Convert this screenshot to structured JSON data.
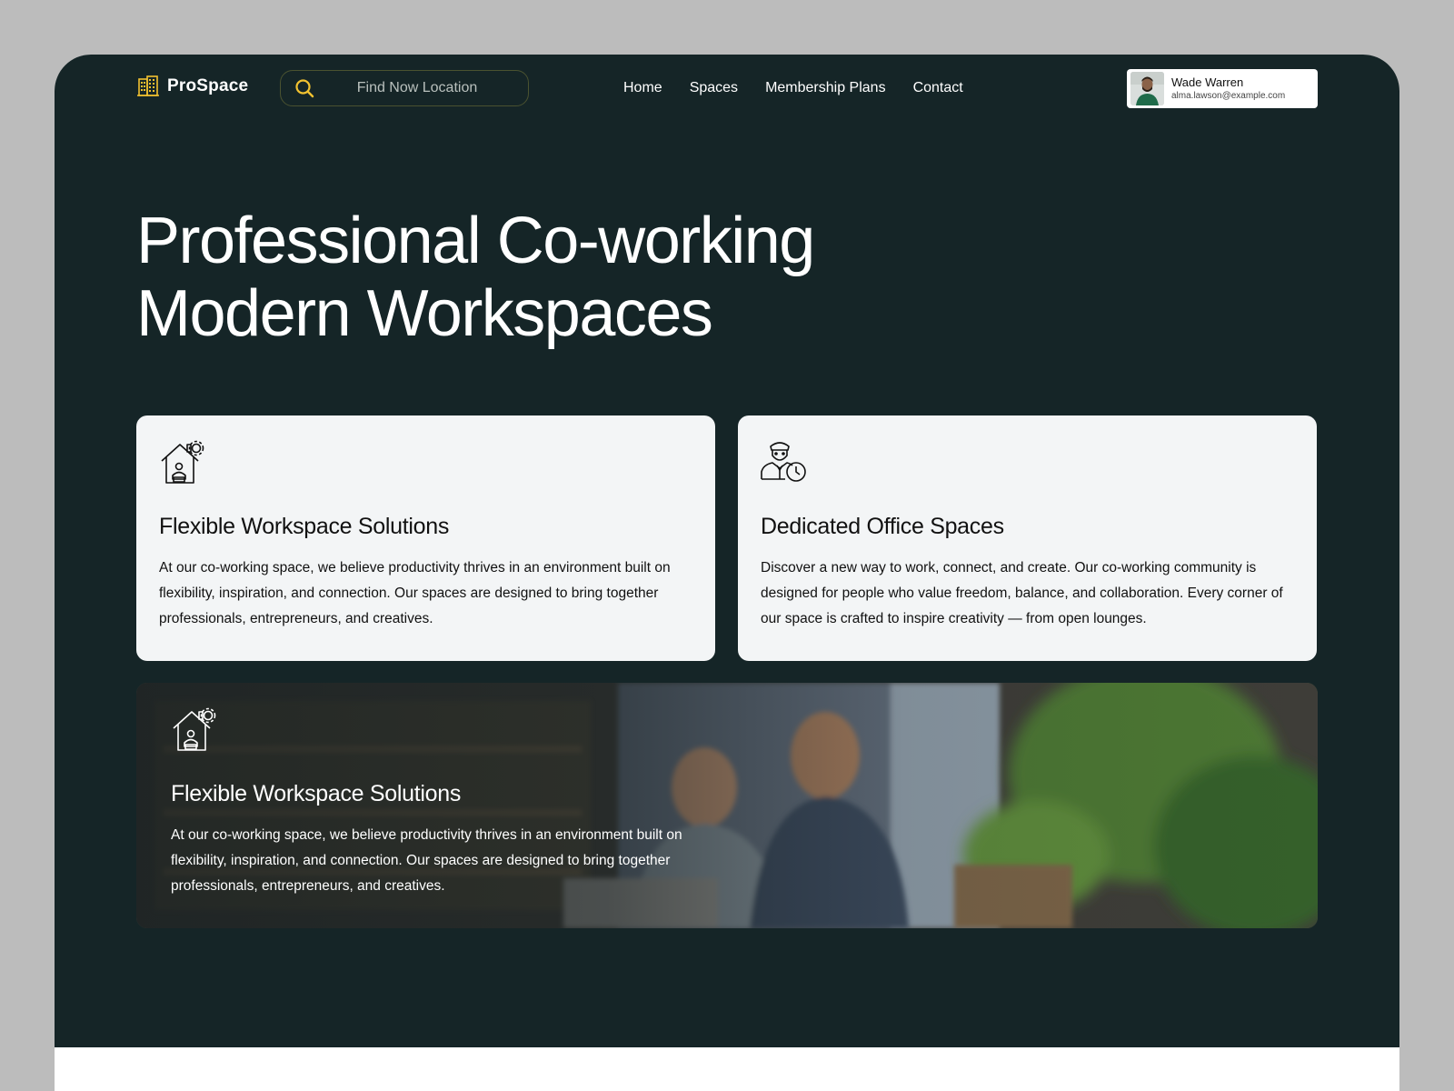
{
  "brand": {
    "name": "ProSpace",
    "accent": "#f2c230"
  },
  "search": {
    "placeholder": "Find Now Location",
    "icon": "search-icon"
  },
  "nav": {
    "items": [
      "Home",
      "Spaces",
      "Membership Plans",
      "Contact"
    ]
  },
  "user": {
    "name": "Wade Warren",
    "email": "alma.lawson@example.com"
  },
  "hero": {
    "line1": "Professional Co-working",
    "line2": "Modern Workspaces"
  },
  "cards": [
    {
      "icon": "house-gear-icon",
      "title": "Flexible Workspace Solutions",
      "body": "At our co-working space, we believe productivity thrives in an environment built on flexibility, inspiration, and connection. Our spaces are designed to bring together professionals, entrepreneurs, and creatives."
    },
    {
      "icon": "person-clock-icon",
      "title": "Dedicated Office Spaces",
      "body": "Discover a new way to work, connect, and create. Our co-working community is designed for people who value freedom, balance, and collaboration. Every corner of our space is crafted to inspire creativity — from open lounges."
    }
  ],
  "banner": {
    "icon": "house-gear-icon",
    "title": "Flexible Workspace Solutions",
    "body": "At our co-working space, we believe productivity thrives in an environment built on flexibility, inspiration, and connection. Our spaces are designed to bring together professionals, entrepreneurs, and creatives."
  },
  "colors": {
    "background": "#152527",
    "card": "#f3f5f6",
    "page": "#bcbcbc"
  }
}
